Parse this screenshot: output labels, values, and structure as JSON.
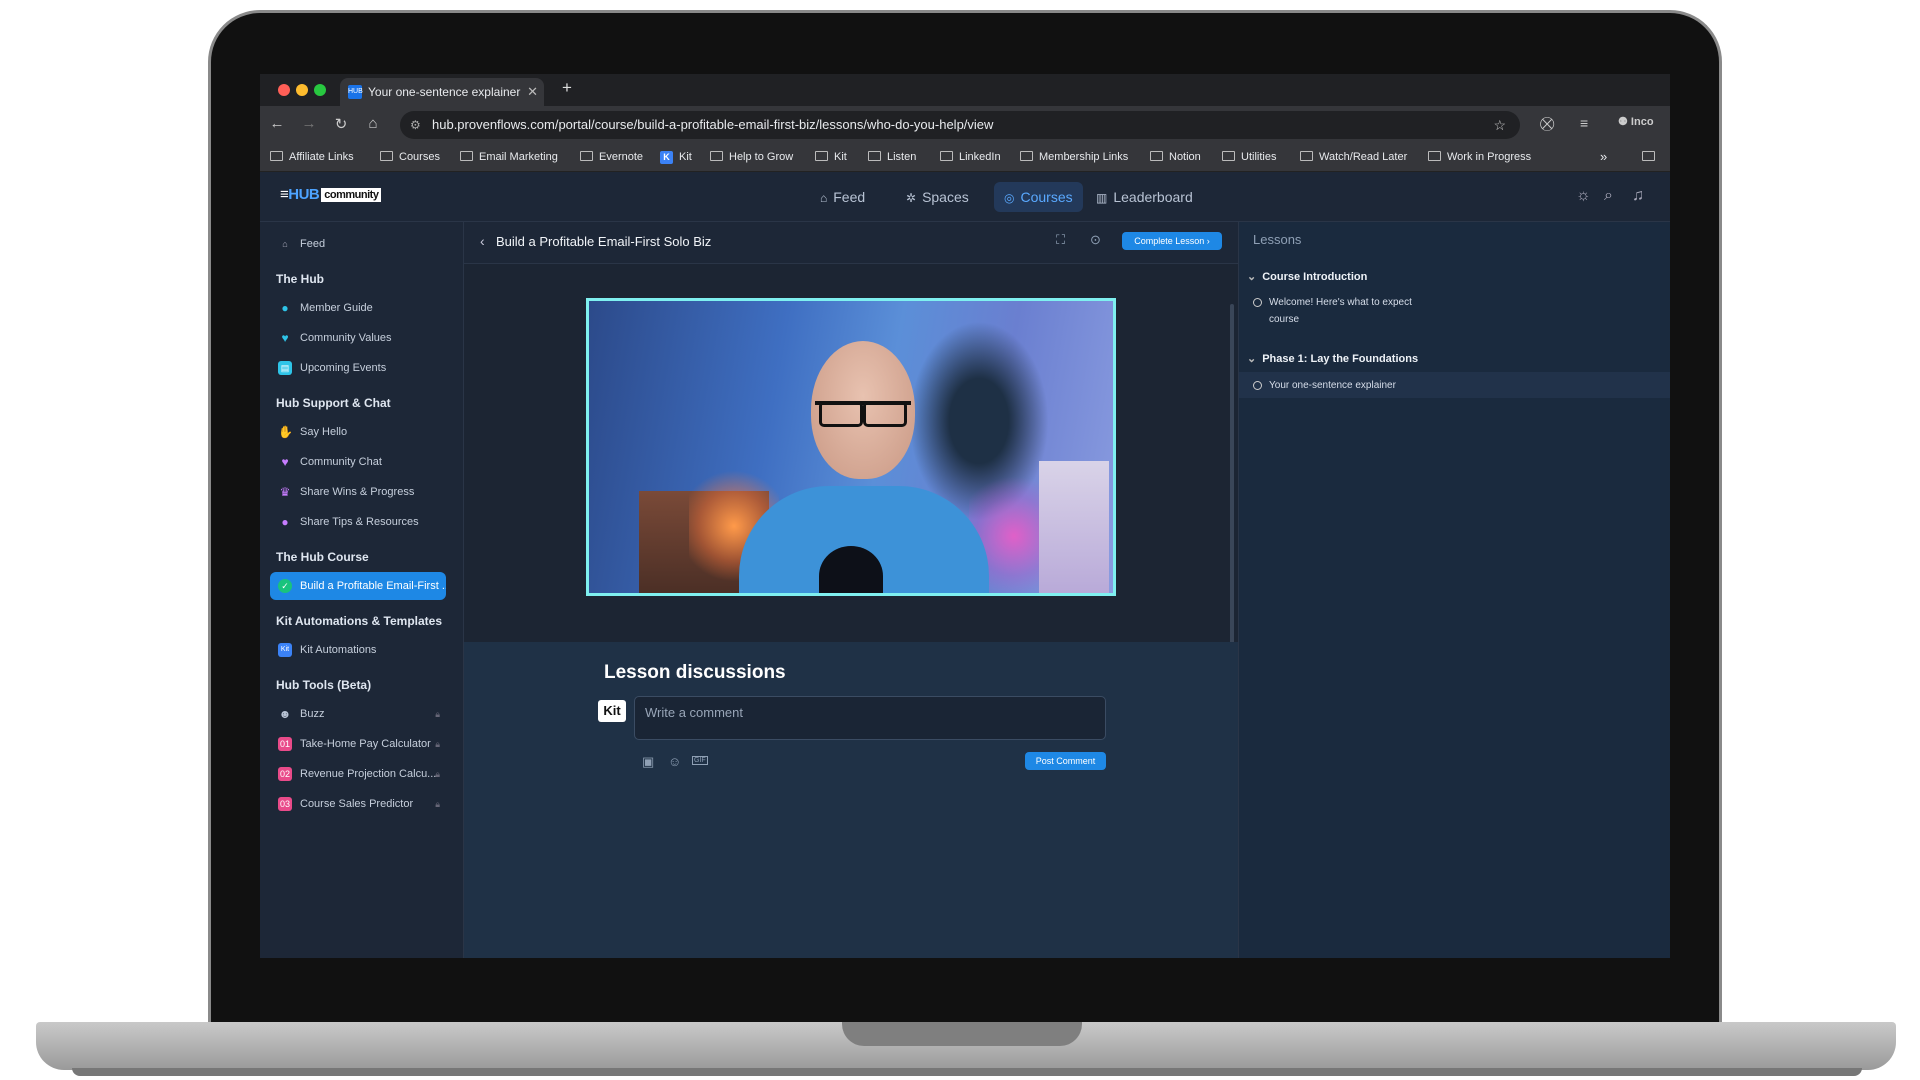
{
  "browser": {
    "tab_title": "Your one-sentence explainer",
    "tab_favicon": "HUB",
    "url": "hub.provenflows.com/portal/course/build-a-profitable-email-first-biz/lessons/who-do-you-help/view",
    "profile_label": "Inco",
    "bookmarks": [
      "Affiliate Links",
      "Courses",
      "Email Marketing",
      "Evernote",
      "Kit",
      "Help to Grow",
      "Kit",
      "Listen",
      "LinkedIn",
      "Membership Links",
      "Notion",
      "Utilities",
      "Watch/Read Later",
      "Work in Progress"
    ],
    "bookmarks_more": "»"
  },
  "app": {
    "logo_prefix": "≡",
    "logo_hub": "HUB",
    "logo_box": "community",
    "nav": [
      {
        "icon": "⌂",
        "label": "Feed"
      },
      {
        "icon": "✲",
        "label": "Spaces"
      },
      {
        "icon": "◎",
        "label": "Courses"
      },
      {
        "icon": "▥",
        "label": "Leaderboard"
      }
    ]
  },
  "sidebar": {
    "feed": "Feed",
    "sections": {
      "hub": "The Hub",
      "support": "Hub Support & Chat",
      "course": "The Hub Course",
      "kit": "Kit Automations & Templates",
      "tools": "Hub Tools (Beta)"
    },
    "items": {
      "member_guide": "Member Guide",
      "community_values": "Community Values",
      "upcoming_events": "Upcoming Events",
      "say_hello": "Say Hello",
      "community_chat": "Community Chat",
      "share_wins": "Share Wins & Progress",
      "share_tips": "Share Tips & Resources",
      "course_link": "Build a Profitable Email-First ...",
      "kit_automations": "Kit Automations",
      "buzz": "Buzz",
      "take_home": "Take-Home Pay Calculator",
      "revenue": "Revenue Projection Calcu...",
      "course_sales": "Course Sales Predictor"
    },
    "tool_badges": [
      "01",
      "02",
      "03"
    ],
    "kit_badge": "Kit"
  },
  "lesson": {
    "title": "Build a Profitable Email-First Solo Biz",
    "complete_label": "Complete Lesson ›"
  },
  "discussion": {
    "title": "Lesson discussions",
    "avatar": "Kit",
    "placeholder": "Write a comment",
    "post_label": "Post Comment",
    "gif_label": "GIF"
  },
  "lessons_panel": {
    "title": "Lessons",
    "section1": "Course Introduction",
    "item1_line1": "Welcome! Here's what to expect",
    "item1_line2": "course",
    "section2": "Phase 1: Lay the Foundations",
    "item2": "Your one-sentence explainer"
  }
}
